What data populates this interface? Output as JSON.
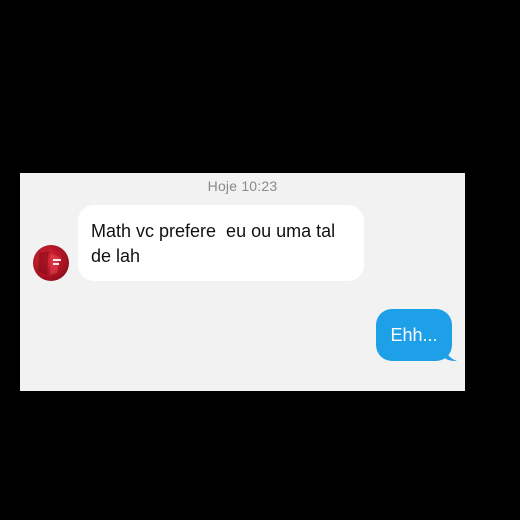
{
  "chat": {
    "timestamp": "Hoje 10:23",
    "incoming": {
      "text": "Math vc prefere  eu ou uma tal\nde lah"
    },
    "outgoing": {
      "text": "Ehh..."
    }
  },
  "colors": {
    "background": "#000000",
    "panel": "#f2f2f2",
    "incoming_bubble": "#ffffff",
    "outgoing_bubble": "#1ea0e8",
    "avatar": "#c8142a"
  },
  "icons": {
    "avatar": "profile-avatar-icon"
  }
}
